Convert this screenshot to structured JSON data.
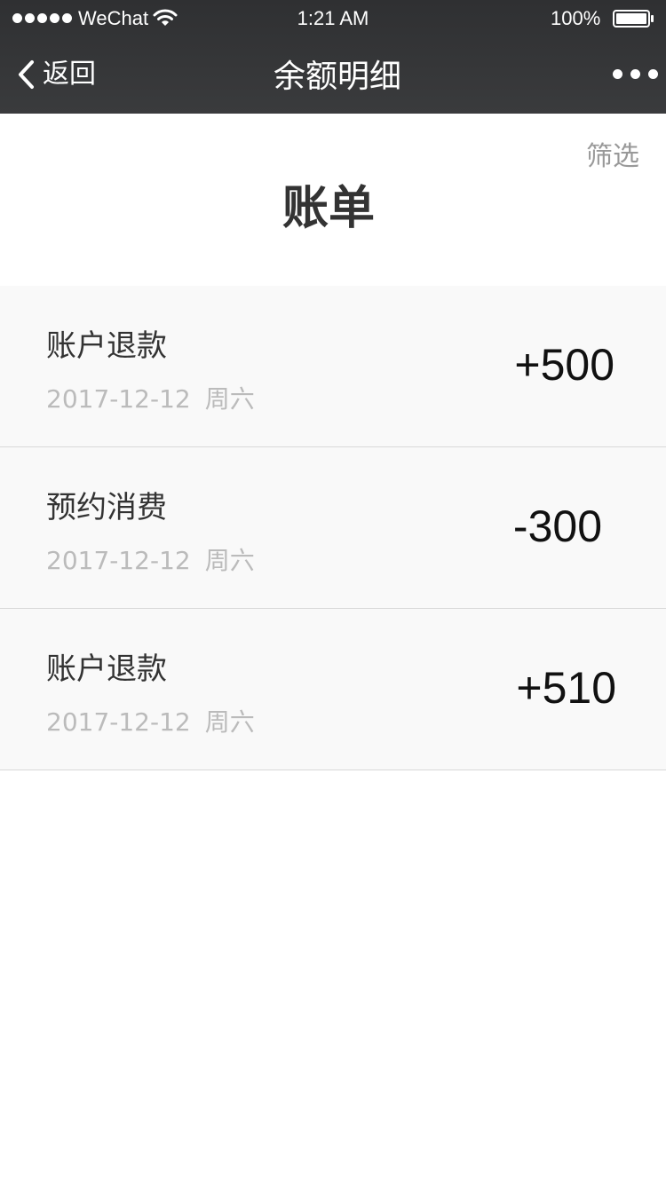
{
  "status_bar": {
    "carrier": "WeChat",
    "time": "1:21 AM",
    "battery": "100%"
  },
  "nav": {
    "back_label": "返回",
    "title": "余额明细"
  },
  "header": {
    "filter_label": "筛选",
    "title": "账单"
  },
  "transactions": [
    {
      "title": "账户退款",
      "date": "2017-12-12",
      "weekday": "周六",
      "amount": "+500"
    },
    {
      "title": "预约消费",
      "date": "2017-12-12",
      "weekday": "周六",
      "amount": "-300"
    },
    {
      "title": "账户退款",
      "date": "2017-12-12",
      "weekday": "周六",
      "amount": "+510"
    }
  ],
  "colors": {
    "nav_background": "#333436",
    "row_background": "#f9f9f9",
    "muted_text": "#bbbbbb",
    "filter_text": "#999999"
  }
}
